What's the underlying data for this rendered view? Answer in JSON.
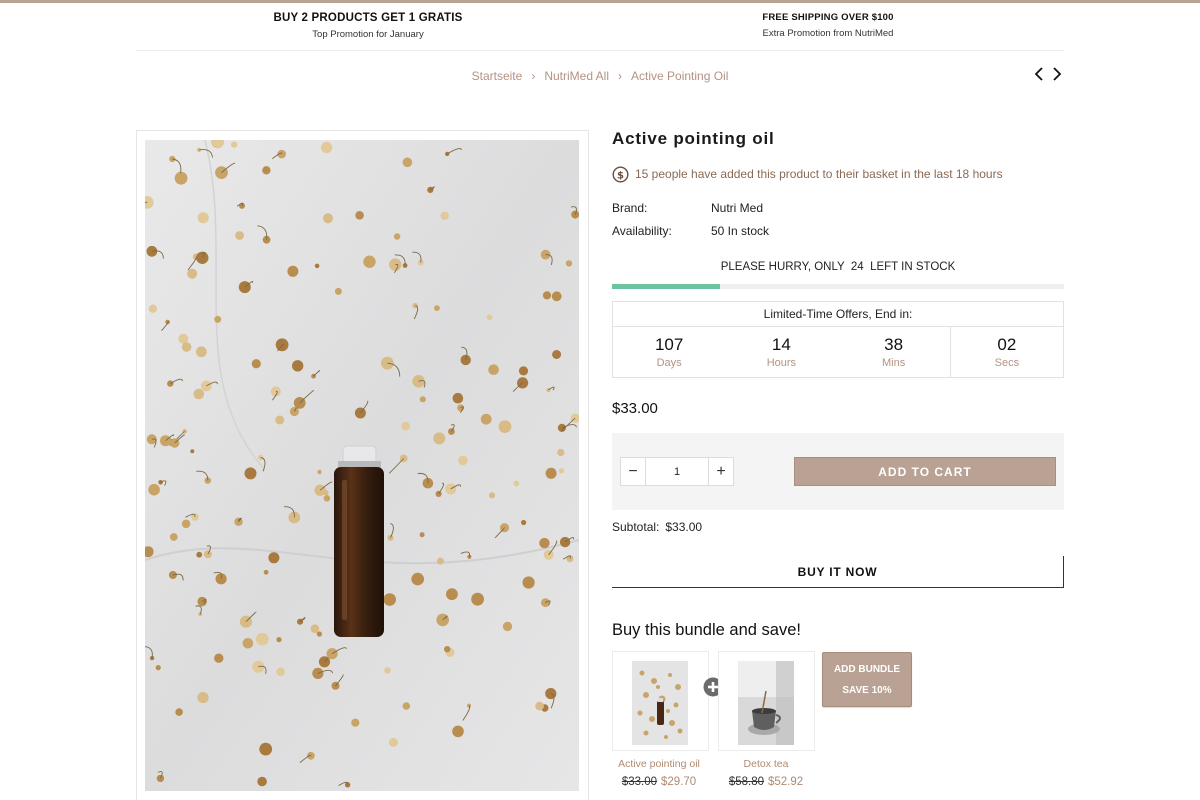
{
  "colors": {
    "accent": "#b9a293",
    "accent_text": "#b39282",
    "stock_bar": "#6cc39f",
    "cart_box_bg": "#f4f4f4"
  },
  "promos": [
    {
      "title": "BUY 2 PRODUCTS GET 1 GRATIS",
      "subtitle": "Top Promotion for January"
    },
    {
      "title": "FREE SHIPPING OVER $100",
      "subtitle": "Extra Promotion from NutriMed"
    }
  ],
  "breadcrumb": [
    "Startseite",
    "NutriMed All",
    "Active Pointing Oil"
  ],
  "pager": {
    "prev_icon": "chevron-left-icon",
    "next_icon": "chevron-right-icon"
  },
  "product": {
    "title": "Active pointing oil",
    "social_proof": "15 people have added this product to their basket in the last 18 hours",
    "brand_label": "Brand:",
    "brand_value": "Nutri Med",
    "availability_label": "Availability:",
    "availability_value": "50 In stock",
    "hurry_text": "PLEASE HURRY, ONLY  24  LEFT IN STOCK",
    "stock_fraction": 0.24,
    "price": "$33.00"
  },
  "countdown": {
    "heading": "Limited-Time Offers, End in:",
    "cells": [
      {
        "value": "107",
        "unit": "Days"
      },
      {
        "value": "14",
        "unit": "Hours"
      },
      {
        "value": "38",
        "unit": "Mins"
      },
      {
        "value": "02",
        "unit": "Secs"
      }
    ]
  },
  "cart": {
    "quantity": "1",
    "minus_label": "−",
    "plus_label": "+",
    "add_to_cart_label": "ADD TO CART",
    "subtotal_label": "Subtotal:",
    "subtotal_value": "$33.00",
    "buy_now_label": "BUY IT NOW"
  },
  "bundle": {
    "title": "Buy this bundle and save!",
    "items": [
      {
        "name": "Active pointing oil",
        "old_price": "$33.00",
        "new_price": "$29.70"
      },
      {
        "name": "Detox tea",
        "old_price": "$58.80",
        "new_price": "$52.92"
      }
    ],
    "button_line1": "ADD BUNDLE",
    "button_line2": "SAVE 10%"
  }
}
